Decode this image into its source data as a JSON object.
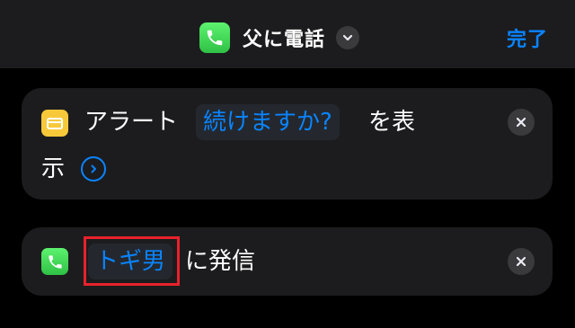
{
  "header": {
    "title": "父に電話",
    "done_label": "完了",
    "app_icon": "phone-icon",
    "menu_icon": "chevron-down-icon"
  },
  "actions": [
    {
      "icon": "alert-window-icon",
      "prefix": "アラート",
      "param": "続けますか?",
      "suffix_1": "を表",
      "suffix_2": "示",
      "expand_icon": "chevron-right-circle-icon",
      "remove_icon": "close-icon"
    },
    {
      "icon": "phone-icon",
      "param": "トギ男",
      "suffix": "に発信",
      "remove_icon": "close-icon"
    }
  ],
  "colors": {
    "background": "#000000",
    "card": "#1c1c1e",
    "accent": "#0a84ff",
    "highlight": "#e8222b",
    "alert_yellow": "#f7c93a",
    "phone_green": "#34c759"
  }
}
